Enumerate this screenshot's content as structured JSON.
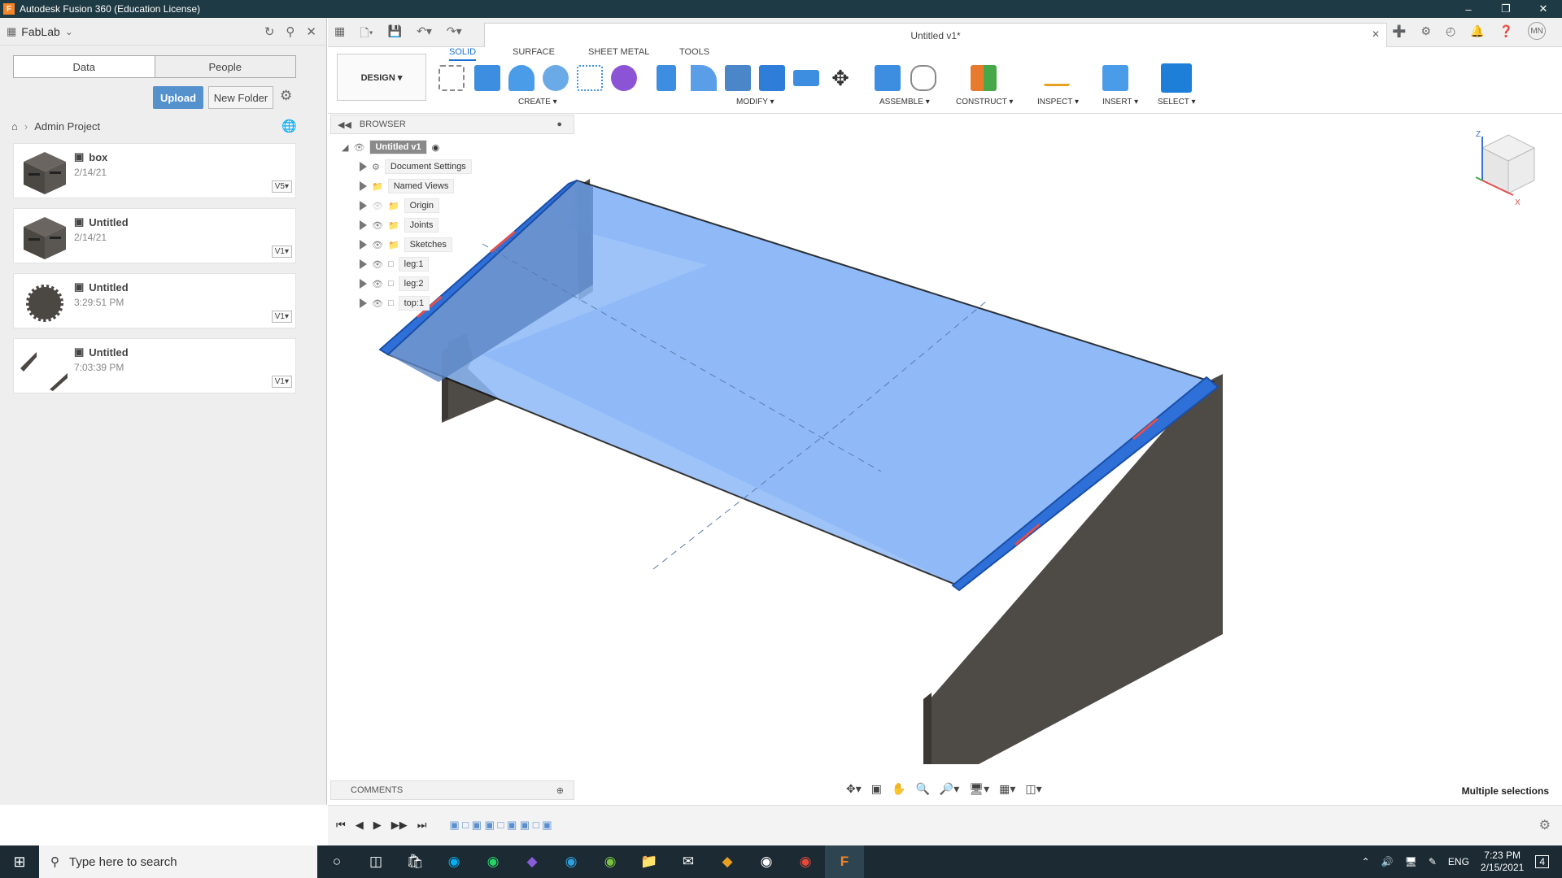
{
  "window": {
    "title": "Autodesk Fusion 360 (Education License)",
    "icon": "F"
  },
  "datapanel": {
    "team": "FabLab",
    "tabs": [
      "Data",
      "People"
    ],
    "upload": "Upload",
    "new_folder": "New Folder",
    "breadcrumb": "Admin Project",
    "files": [
      {
        "name": "box",
        "date": "2/14/21",
        "version": "V5▾"
      },
      {
        "name": "Untitled",
        "date": "2/14/21",
        "version": "V1▾"
      },
      {
        "name": "Untitled",
        "date": "3:29:51 PM",
        "version": "V1▾"
      },
      {
        "name": "Untitled",
        "date": "7:03:39 PM",
        "version": "V1▾"
      }
    ]
  },
  "document": {
    "tab_title": "Untitled v1*"
  },
  "toolbar": {
    "workspace": "DESIGN ▾",
    "tabs": [
      "SOLID",
      "SURFACE",
      "SHEET METAL",
      "TOOLS"
    ],
    "groups": [
      "CREATE ▾",
      "MODIFY ▾",
      "ASSEMBLE ▾",
      "CONSTRUCT ▾",
      "INSPECT ▾",
      "INSERT ▾",
      "SELECT ▾"
    ]
  },
  "browser": {
    "title": "BROWSER",
    "root": "Untitled v1",
    "items": [
      "Document Settings",
      "Named Views",
      "Origin",
      "Joints",
      "Sketches",
      "leg:1",
      "leg:2",
      "top:1"
    ]
  },
  "comments": "COMMENTS",
  "status": "Multiple selections",
  "user_initials": "MN",
  "taskbar": {
    "search_placeholder": "Type here to search",
    "lang": "ENG",
    "time": "7:23 PM",
    "date": "2/15/2021",
    "notif": "4"
  },
  "colors": {
    "accent": "#1b6fd1",
    "titlebar": "#1e3a44",
    "selection": "#7fb1f6",
    "leg": "#4e4a46"
  }
}
